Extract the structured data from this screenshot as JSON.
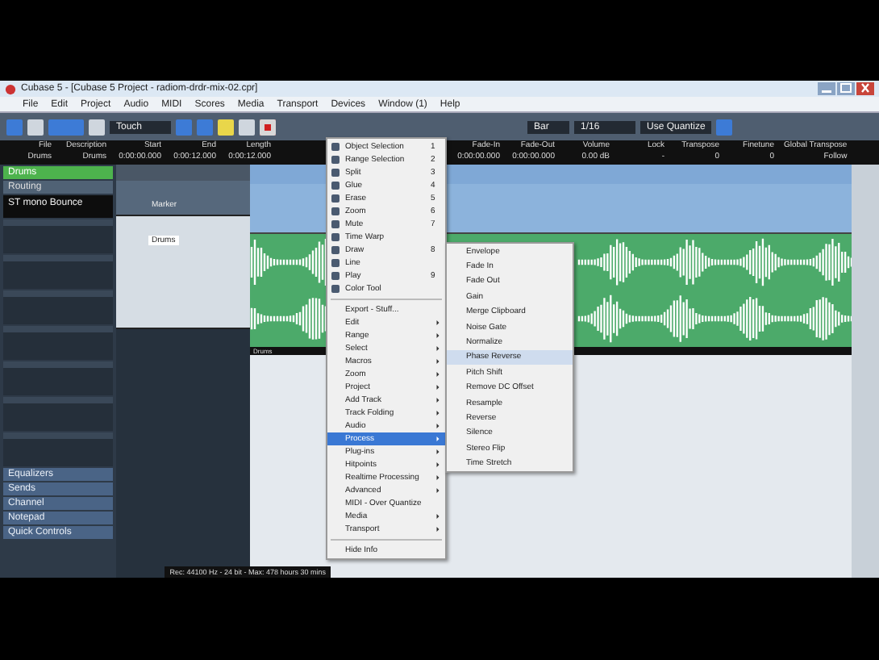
{
  "window": {
    "title": "Cubase 5 - [Cubase 5 Project - radiom-drdr-mix-02.cpr]"
  },
  "menu_bar": [
    "File",
    "Edit",
    "Project",
    "Audio",
    "MIDI",
    "Scores",
    "Media",
    "Transport",
    "Devices",
    "Window (1)",
    "Help"
  ],
  "toolbar": {
    "automation_mode": "Touch",
    "grid": "Bar",
    "quantize": "1/16",
    "quantize_mode": "Use Quantize"
  },
  "info_line": [
    {
      "label": "File",
      "value": "Drums"
    },
    {
      "label": "Description",
      "value": "Drums"
    },
    {
      "label": "Start",
      "value": "0:00:00.000"
    },
    {
      "label": "End",
      "value": "0:00:12.000"
    },
    {
      "label": "Length",
      "value": "0:00:12.000"
    },
    {
      "label": "Fade-In",
      "value": "0:00:00.000"
    },
    {
      "label": "Fade-Out",
      "value": "0:00:00.000"
    },
    {
      "label": "Volume",
      "value": "0.00 dB"
    },
    {
      "label": "Lock",
      "value": "-"
    },
    {
      "label": "Transpose",
      "value": "0"
    },
    {
      "label": "Finetune",
      "value": "0"
    },
    {
      "label": "Global Transpose",
      "value": "Follow"
    }
  ],
  "inspector": {
    "header": "Drums",
    "routing": "Routing",
    "output": "ST mono Bounce",
    "sections": [
      "Equalizers",
      "Sends",
      "Channel",
      "Notepad",
      "Quick Controls"
    ]
  },
  "tracks": [
    {
      "name": "Marker",
      "selected": false
    },
    {
      "name": "Drums",
      "selected": true
    }
  ],
  "event": {
    "name": "Drums"
  },
  "context_menu": [
    {
      "kind": "tool",
      "label": "Object Selection",
      "shortcut": "1",
      "selected": false
    },
    {
      "kind": "tool",
      "label": "Range Selection",
      "shortcut": "2",
      "selected": false
    },
    {
      "kind": "tool",
      "label": "Split",
      "shortcut": "3",
      "selected": false
    },
    {
      "kind": "tool",
      "label": "Glue",
      "shortcut": "4",
      "selected": false
    },
    {
      "kind": "tool",
      "label": "Erase",
      "shortcut": "5",
      "selected": false
    },
    {
      "kind": "tool",
      "label": "Zoom",
      "shortcut": "6",
      "selected": false
    },
    {
      "kind": "tool",
      "label": "Mute",
      "shortcut": "7",
      "selected": false
    },
    {
      "kind": "tool",
      "label": "Time Warp",
      "selected": false
    },
    {
      "kind": "tool",
      "label": "Draw",
      "shortcut": "8",
      "selected": false
    },
    {
      "kind": "tool",
      "label": "Line",
      "selected": false
    },
    {
      "kind": "tool",
      "label": "Play",
      "shortcut": "9",
      "selected": false
    },
    {
      "kind": "tool",
      "label": "Color Tool",
      "selected": false
    },
    {
      "kind": "separator"
    },
    {
      "kind": "item",
      "label": "Export - Stuff...",
      "selected": false
    },
    {
      "kind": "submenu",
      "label": "Edit",
      "selected": false
    },
    {
      "kind": "submenu",
      "label": "Range",
      "selected": false
    },
    {
      "kind": "submenu",
      "label": "Select",
      "selected": false
    },
    {
      "kind": "submenu",
      "label": "Macros",
      "selected": false
    },
    {
      "kind": "submenu",
      "label": "Zoom",
      "selected": false
    },
    {
      "kind": "submenu",
      "label": "Project",
      "selected": false
    },
    {
      "kind": "submenu",
      "label": "Add Track",
      "selected": false
    },
    {
      "kind": "submenu",
      "label": "Track Folding",
      "selected": false
    },
    {
      "kind": "submenu",
      "label": "Audio",
      "selected": false
    },
    {
      "kind": "submenu",
      "label": "Process",
      "selected": true
    },
    {
      "kind": "submenu",
      "label": "Plug-ins",
      "selected": false
    },
    {
      "kind": "submenu",
      "label": "Hitpoints",
      "selected": false
    },
    {
      "kind": "submenu",
      "label": "Realtime Processing",
      "selected": false
    },
    {
      "kind": "submenu",
      "label": "Advanced",
      "selected": false
    },
    {
      "kind": "item",
      "label": "MIDI - Over Quantize",
      "selected": false
    },
    {
      "kind": "submenu",
      "label": "Media",
      "selected": false
    },
    {
      "kind": "submenu",
      "label": "Transport",
      "selected": false
    },
    {
      "kind": "separator"
    },
    {
      "kind": "item",
      "label": "Hide Info",
      "selected": false
    }
  ],
  "process_submenu": [
    {
      "label": "Envelope",
      "selected": false
    },
    {
      "label": "Fade In",
      "selected": false
    },
    {
      "label": "Fade Out",
      "selected": false
    },
    {
      "label": "Gain",
      "selected": false
    },
    {
      "label": "Merge Clipboard",
      "selected": false
    },
    {
      "label": "Noise Gate",
      "selected": false
    },
    {
      "label": "Normalize",
      "selected": false
    },
    {
      "label": "Phase Reverse",
      "selected": true
    },
    {
      "label": "Pitch Shift",
      "selected": false
    },
    {
      "label": "Remove DC Offset",
      "selected": false
    },
    {
      "label": "Resample",
      "selected": false
    },
    {
      "label": "Reverse",
      "selected": false
    },
    {
      "label": "Silence",
      "selected": false
    },
    {
      "label": "Stereo Flip",
      "selected": false
    },
    {
      "label": "Time Stretch",
      "selected": false
    }
  ],
  "status_bar": "Rec: 44100 Hz - 24 bit - Max: 478 hours 30 mins"
}
